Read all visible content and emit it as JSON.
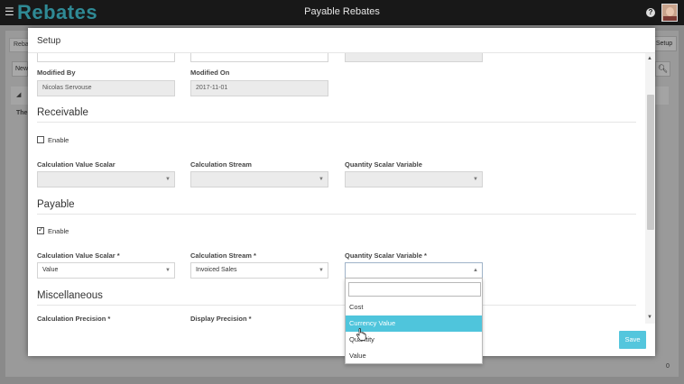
{
  "app": {
    "brand": "Rebates",
    "title": "Payable Rebates",
    "help_symbol": "?"
  },
  "background": {
    "tab_label": "Reba",
    "new_button": "New",
    "setup_button": "Setup",
    "row_text": "The",
    "footer_count": "0"
  },
  "modal": {
    "title": "Setup",
    "modified_by": {
      "label": "Modified By",
      "value": "Nicolas Servouse"
    },
    "modified_on": {
      "label": "Modified On",
      "value": "2017-11-01"
    },
    "receivable": {
      "heading": "Receivable",
      "enable_label": "Enable",
      "enabled": false,
      "calc_value_scalar_label": "Calculation Value Scalar",
      "calc_stream_label": "Calculation Stream",
      "qty_scalar_label": "Quantity Scalar Variable"
    },
    "payable": {
      "heading": "Payable",
      "enable_label": "Enable",
      "enabled": true,
      "calc_value_scalar_label": "Calculation Value Scalar *",
      "calc_value_scalar_value": "Value",
      "calc_stream_label": "Calculation Stream *",
      "calc_stream_value": "Invoiced Sales",
      "qty_scalar_label": "Quantity Scalar Variable *",
      "qty_scalar_value": ""
    },
    "misc": {
      "heading": "Miscellaneous",
      "calc_precision_label": "Calculation Precision *",
      "display_precision_label": "Display Precision *"
    },
    "save_label": "Save"
  },
  "dropdown": {
    "search_value": "",
    "options": [
      "Cost",
      "Currency Value",
      "Quantity",
      "Value"
    ],
    "highlighted": "Currency Value"
  },
  "colors": {
    "accent": "#4fc5dc",
    "brand": "#2f8a95",
    "topbar": "#181818"
  }
}
